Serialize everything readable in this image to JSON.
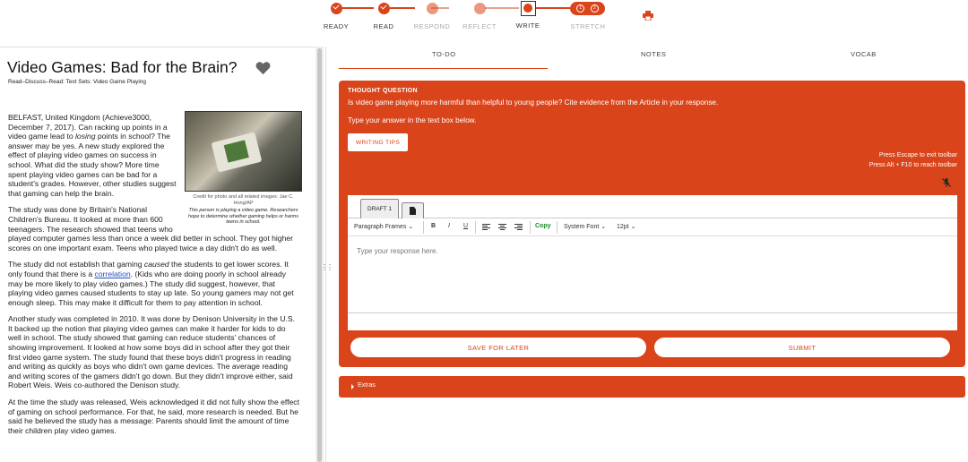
{
  "steps": [
    {
      "label": "READY",
      "state": "done"
    },
    {
      "label": "READ",
      "state": "done"
    },
    {
      "label": "RESPOND",
      "state": "incomplete"
    },
    {
      "label": "REFLECT",
      "state": "incomplete"
    },
    {
      "label": "WRITE",
      "state": "current"
    },
    {
      "label": "STRETCH",
      "state": "locked"
    }
  ],
  "stretch_icons": [
    "1",
    "2"
  ],
  "print_icon": "printer-icon",
  "article": {
    "title": "Video Games: Bad for the Brain?",
    "breadcrumb": "Read–Discuss–Read: Text Sets: Video Game Playing",
    "photo_credit": "Credit for photo and all related images: Jae C. Hong/AP",
    "photo_caption": "This person is playing a video game. Researchers hope to determine whether gaming helps or harms teens in school.",
    "p1_a": "BELFAST, United Kingdom (Achieve3000, December 7, 2017). Can racking up points in a video game lead to ",
    "p1_em": "losing",
    "p1_b": " points in school? The answer may be yes. A new study explored the effect of playing video games on success in school. What did the study show? More time spent playing video games can be bad for a student's grades. However, other studies suggest that gaming can help the brain.",
    "p2": "The study was done by Britain's National Children's Bureau. It looked at more than 600 teenagers. The research showed that teens who played computer games less than once a week did better in school. They got higher scores on one important exam. Teens who played twice a day didn't do as well.",
    "p3_a": "The study did not establish that gaming ",
    "p3_em": "caused",
    "p3_b": " the students to get lower scores. It only found that there is a ",
    "p3_link": "correlation",
    "p3_c": ". (Kids who are doing poorly in school already may be more likely to play video games.) The study did suggest, however, that playing video games caused students to stay up late. So young gamers may not get enough sleep. This may make it difficult for them to pay attention in school.",
    "p4": "Another study was completed in 2010. It was done by Denison University in the U.S. It backed up the notion that playing video games can make it harder for kids to do well in school. The study showed that gaming can reduce students' chances of showing improvement. It looked at how some boys did in school after they got their first video game system. The study found that these boys didn't progress in reading and writing as quickly as boys who didn't own game devices. The average reading and writing scores of the gamers didn't go down. But they didn't improve either, said Robert Weis. Weis co-authored the Denison study.",
    "p5": "At the time the study was released, Weis acknowledged it did not fully show the effect of gaming on school performance. For that, he said, more research is needed. But he said he believed the study has a message: Parents should limit the amount of time their children play video games."
  },
  "tabs": [
    "TO-DO",
    "NOTES",
    "VOCAB"
  ],
  "thought": {
    "label": "THOUGHT QUESTION",
    "question": "Is video game playing more harmful than helpful to young people? Cite evidence from the Article in your response.",
    "instruction": "Type your answer in the text box below.",
    "writing_tips": "WRITING TIPS",
    "esc_hint": "Press Escape to exit toolbar",
    "alt_hint": "Press Alt + F10 to reach toolbar"
  },
  "editor": {
    "draft_tab": "DRAFT 1",
    "format": "Paragraph Frames",
    "bold": "B",
    "italic": "I",
    "underline": "U",
    "copy": "Copy",
    "font": "System Font",
    "size": "12pt",
    "placeholder": "Type your response here."
  },
  "buttons": {
    "save": "SAVE FOR LATER",
    "submit": "SUBMIT"
  },
  "extras": "Extras",
  "colors": {
    "accent": "#d9441a"
  }
}
